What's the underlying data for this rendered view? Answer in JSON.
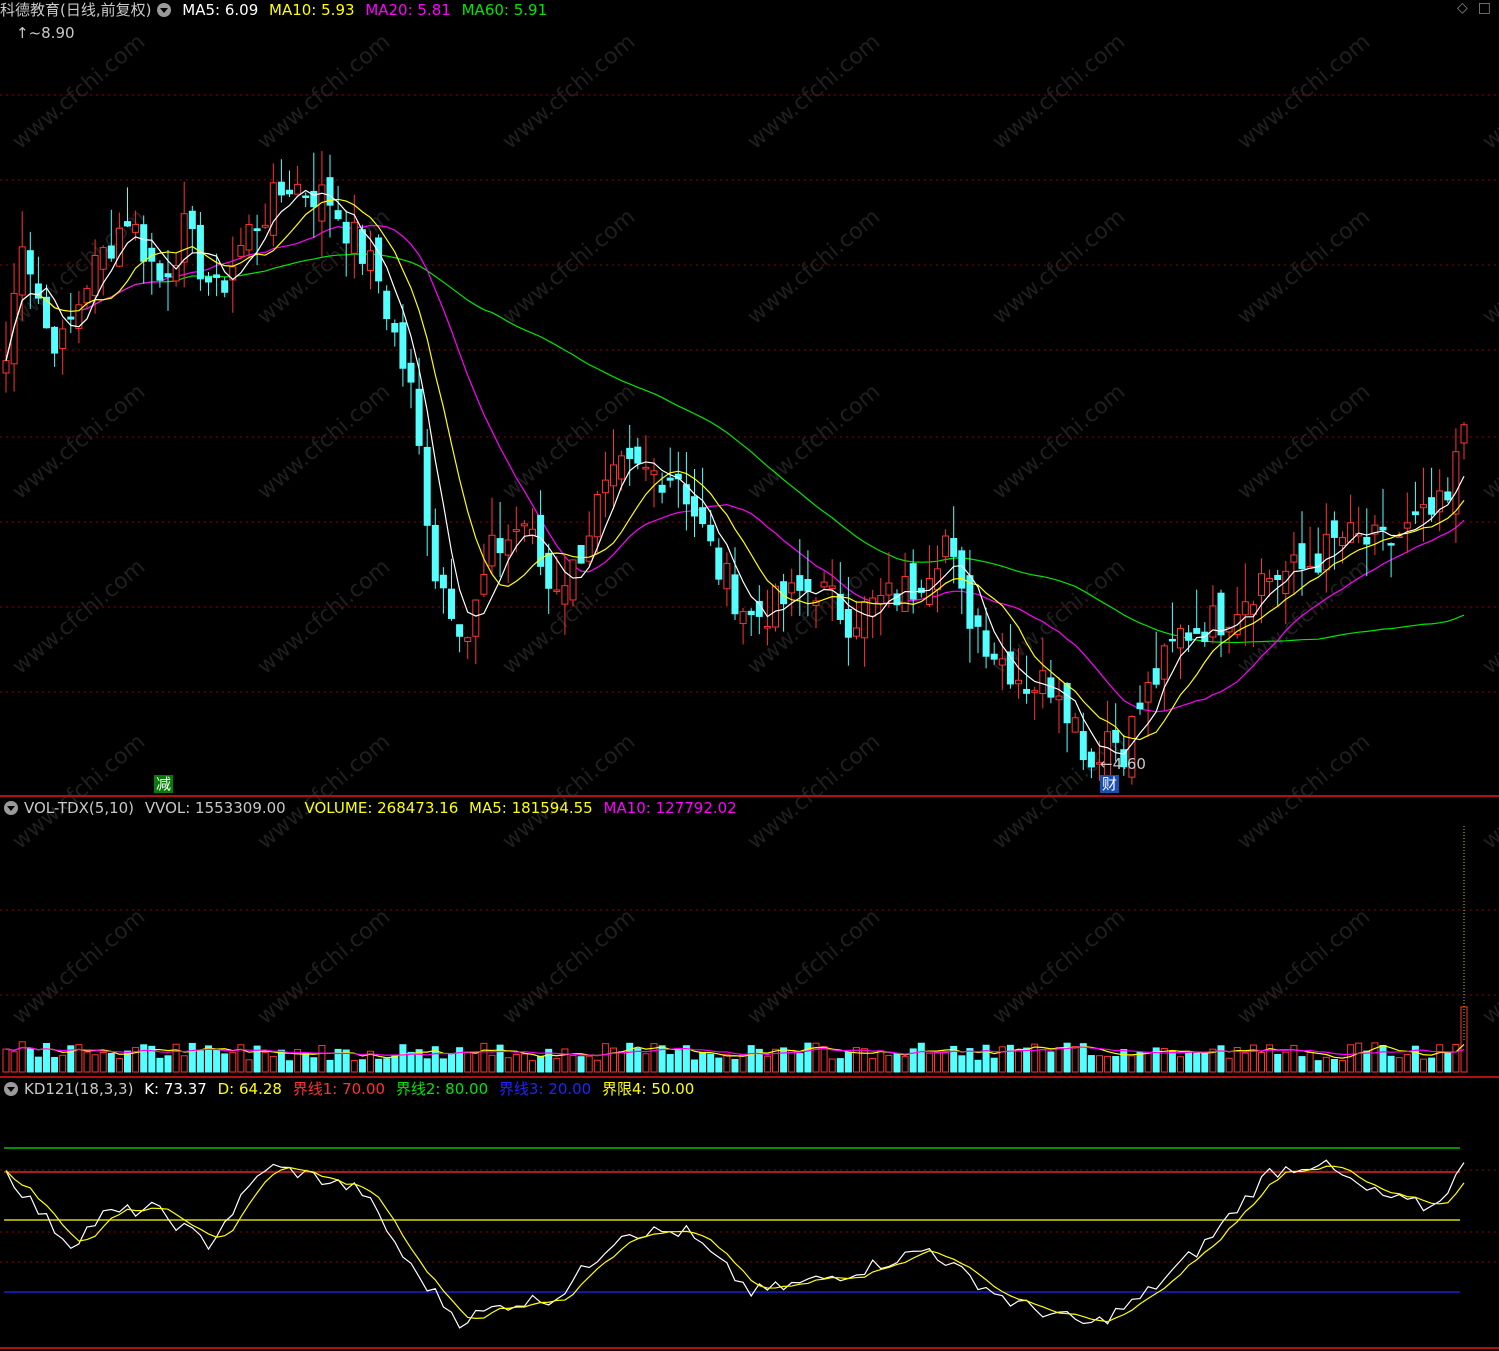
{
  "main": {
    "title": "科德教育(日线,前复权)",
    "ma5": "MA5: 6.09",
    "ma10": "MA10: 5.93",
    "ma20": "MA20: 5.81",
    "ma60": "MA60: 5.91",
    "high_label": "8.90",
    "low_label": "4.60",
    "tag_reduce": "减",
    "tag_cai": "财",
    "colors": {
      "up": "#ff3232",
      "down": "#54ffff",
      "ma5": "#ffffff",
      "ma10": "#ffff00",
      "ma20": "#ff00ff",
      "ma60": "#00e600",
      "grid": "#8b0000"
    }
  },
  "vol": {
    "name": "VOL-TDX(5,10)",
    "vvol": "VVOL: 1553309.00",
    "volume": "VOLUME: 268473.16",
    "ma5": "MA5: 181594.55",
    "ma10": "MA10: 127792.02"
  },
  "kd": {
    "name": "KD121(18,3,3)",
    "k": "K: 73.37",
    "d": "D: 64.28",
    "line1": "界线1: 70.00",
    "line2": "界线2: 80.00",
    "line3": "界线3: 20.00",
    "line4": "界限4: 50.00"
  },
  "icons": [
    "diamond-icon",
    "maximize-icon"
  ],
  "watermark": "www.cfchi.com"
}
